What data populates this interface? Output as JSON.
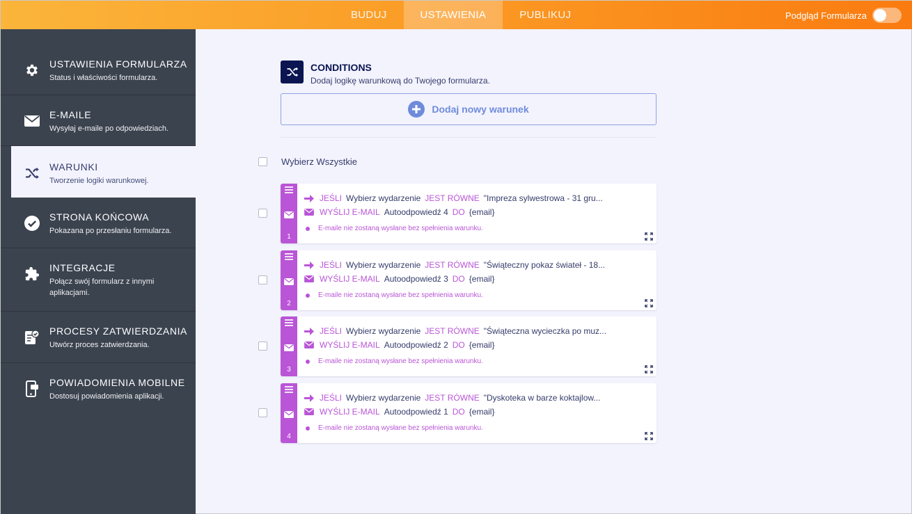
{
  "topbar": {
    "tabs": [
      "BUDUJ",
      "USTAWIENIA",
      "PUBLIKUJ"
    ],
    "active_tab": 1,
    "preview_label": "Podgląd Formularza"
  },
  "sidebar": {
    "items": [
      {
        "title": "USTAWIENIA FORMULARZA",
        "sub": "Status i właściwości formularza.",
        "icon": "gear-icon"
      },
      {
        "title": "E-MAILE",
        "sub": "Wysyłaj e-maile po odpowiedziach.",
        "icon": "envelope-icon"
      },
      {
        "title": "WARUNKI",
        "sub": "Tworzenie logiki warunkowej.",
        "icon": "shuffle-icon"
      },
      {
        "title": "STRONA KOŃCOWA",
        "sub": "Pokazana po przesłaniu formularza.",
        "icon": "check-circle-icon"
      },
      {
        "title": "INTEGRACJE",
        "sub": "Połącz swój formularz z innymi aplikacjami.",
        "icon": "puzzle-icon"
      },
      {
        "title": "PROCESY ZATWIERDZANIA",
        "sub": "Utwórz proces zatwierdzania.",
        "icon": "approval-icon"
      },
      {
        "title": "POWIADOMIENIA MOBILNE",
        "sub": "Dostosuj powiadomienia aplikacji.",
        "icon": "mobile-icon"
      }
    ],
    "active_index": 2
  },
  "main": {
    "title": "CONDITIONS",
    "subtitle": "Dodaj logikę warunkową do Twojego formularza.",
    "add_button": "Dodaj nowy warunek",
    "select_all": "Wybierz Wszystkie",
    "conditions": [
      {
        "number": "1",
        "if_kw": "JEŚLI",
        "field": "Wybierz wydarzenie",
        "op": "JEST RÓWNE",
        "value": "\"Impreza sylwestrowa - 31 gru...",
        "action": "WYŚLIJ E-MAIL",
        "target": "Autoodpowiedź 4",
        "to_kw": "DO",
        "recipient": "{email}",
        "note": "E-maile nie zostaną wysłane bez spełnienia warunku."
      },
      {
        "number": "2",
        "if_kw": "JEŚLI",
        "field": "Wybierz wydarzenie",
        "op": "JEST RÓWNE",
        "value": "\"Świąteczny pokaz świateł - 18...",
        "action": "WYŚLIJ E-MAIL",
        "target": "Autoodpowiedź 3",
        "to_kw": "DO",
        "recipient": "{email}",
        "note": "E-maile nie zostaną wysłane bez spełnienia warunku."
      },
      {
        "number": "3",
        "if_kw": "JEŚLI",
        "field": "Wybierz wydarzenie",
        "op": "JEST RÓWNE",
        "value": "\"Świąteczna wycieczka po muz...",
        "action": "WYŚLIJ E-MAIL",
        "target": "Autoodpowiedź 2",
        "to_kw": "DO",
        "recipient": "{email}",
        "note": "E-maile nie zostaną wysłane bez spełnienia warunku."
      },
      {
        "number": "4",
        "if_kw": "JEŚLI",
        "field": "Wybierz wydarzenie",
        "op": "JEST RÓWNE",
        "value": "\"Dyskoteka w barze koktajlow...",
        "action": "WYŚLIJ E-MAIL",
        "target": "Autoodpowiedź 1",
        "to_kw": "DO",
        "recipient": "{email}",
        "note": "E-maile nie zostaną wysłane bez spełnienia warunku."
      }
    ]
  },
  "colors": {
    "accent_orange": "#fa7b10",
    "sidebar_bg": "#3b434f",
    "condition_purple": "#b955d6",
    "navy": "#0a1551",
    "add_blue": "#6f8bdb"
  }
}
